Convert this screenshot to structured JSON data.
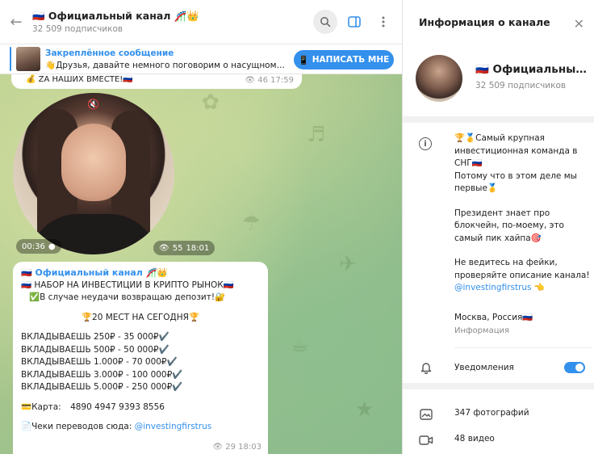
{
  "chat": {
    "title": "🇷🇺 Официальный канал 🎢👑",
    "subscribers": "32 509 подписчиков",
    "pinned": {
      "title": "Закреплённое сообщение",
      "text": "👋Друзья, давайте немного поговорим о насущном? С…",
      "button": "НАПИСАТЬ МНЕ"
    },
    "messages": [
      {
        "type": "text-tail",
        "text": "💰 ZA НАШИХ ВМЕСТЕ!🇷🇺",
        "views": "46",
        "time": "17:59"
      },
      {
        "type": "video-round",
        "duration": "00:36",
        "views": "55",
        "time": "18:01"
      },
      {
        "type": "post",
        "author": "🇷🇺 Официальный канал 🎢👑",
        "line1": "🇷🇺 НАБОР НА ИНВЕСТИЦИИ В КРИПТО РЫНОК🇷🇺",
        "line2": "✅В случае неудачи возвращаю депозит!🔐",
        "highlight": "🏆20 МЕСТ НА СЕГОДНЯ🏆",
        "offers": [
          "ВКЛАДЫВАЕШЬ 250₽ - 35 000₽✔️",
          "ВКЛАДЫВАЕШЬ 500₽ - 50 000₽✔️",
          "ВКЛАДЫВАЕШЬ 1.000₽ - 70 000₽✔️",
          "ВКЛАДЫВАЕШЬ 3.000₽ - 100 000₽✔️",
          "ВКЛАДЫВАЕШЬ 5.000₽ - 250 000₽✔️"
        ],
        "card_label": "💳Карта:",
        "card_number": "4890 4947 9393 8556",
        "receipts_label": "📄Чеки переводов сюда:",
        "receipts_link": "@investingfirstrus",
        "views": "29",
        "time": "18:03"
      }
    ]
  },
  "info": {
    "header": "Информация о канале",
    "name": "🇷🇺 Официальный …",
    "subscribers": "32 509 подписчиков",
    "description": [
      "🏆🥇Самый крупная инвестиционная команда в СНГ🇷🇺",
      "Потому что в этом деле мы первые🥇",
      "Президент знает про блокчейн, по-моему, это самый пик хайпа🎯",
      "Не ведитесь на фейки, проверяйте описание канала!"
    ],
    "description_link": "@investingfirstrus",
    "description_link_suffix": "👈",
    "location": "Москва, Россия🇷🇺",
    "location_label": "Информация",
    "notifications_label": "Уведомления",
    "notifications_on": true,
    "media": [
      {
        "label": "347 фотографий",
        "icon": "photo-icon"
      },
      {
        "label": "48 видео",
        "icon": "video-icon"
      }
    ]
  },
  "colors": {
    "accent": "#3390ec",
    "muted": "#8a8a8a",
    "wallpaper_a": "#b9cf8e",
    "wallpaper_b": "#86b58a"
  }
}
